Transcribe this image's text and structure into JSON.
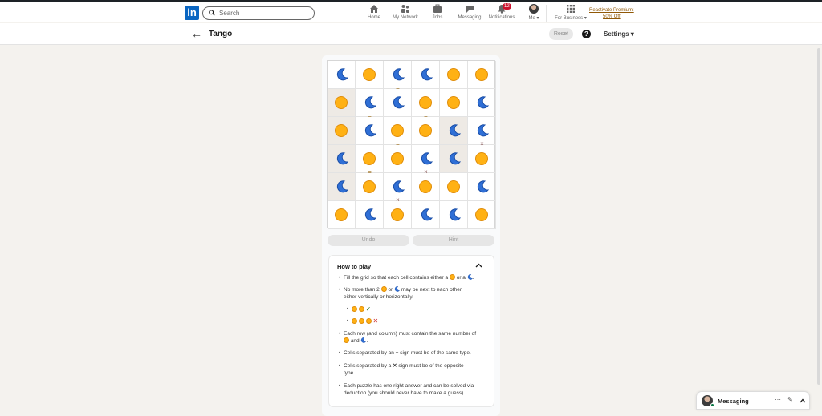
{
  "topbar": {
    "logo": "in",
    "search_placeholder": "Search",
    "nav": [
      {
        "label": "Home",
        "icon": "home-icon"
      },
      {
        "label": "My Network",
        "icon": "network-icon"
      },
      {
        "label": "Jobs",
        "icon": "jobs-icon"
      },
      {
        "label": "Messaging",
        "icon": "messaging-icon"
      },
      {
        "label": "Notifications",
        "icon": "bell-icon",
        "badge": "12"
      },
      {
        "label": "Me ▾",
        "icon": "avatar"
      },
      {
        "label": "For Business ▾",
        "icon": "grid-icon"
      }
    ],
    "premium_line1": "Reactivate Premium:",
    "premium_line2": "50% Off"
  },
  "subbar": {
    "back_glyph": "←",
    "title": "Tango",
    "reset": "Reset",
    "help_glyph": "?",
    "settings": "Settings ▾"
  },
  "game": {
    "grid": [
      [
        "M",
        "S",
        "M",
        "M",
        "S",
        "S"
      ],
      [
        "S",
        "M",
        "M",
        "S",
        "S",
        "M"
      ],
      [
        "S",
        "M",
        "S",
        "S",
        "M",
        "M"
      ],
      [
        "M",
        "S",
        "S",
        "M",
        "M",
        "S"
      ],
      [
        "M",
        "S",
        "M",
        "S",
        "S",
        "M"
      ],
      [
        "S",
        "M",
        "S",
        "M",
        "M",
        "S"
      ]
    ],
    "locked": [
      [
        1,
        0
      ],
      [
        2,
        0
      ],
      [
        2,
        4
      ],
      [
        3,
        0
      ],
      [
        3,
        4
      ],
      [
        4,
        0
      ]
    ],
    "signs": [
      {
        "between": [
          [
            0,
            2
          ],
          [
            1,
            2
          ]
        ],
        "type": "="
      },
      {
        "between": [
          [
            1,
            1
          ],
          [
            2,
            1
          ]
        ],
        "type": "="
      },
      {
        "between": [
          [
            1,
            3
          ],
          [
            2,
            3
          ]
        ],
        "type": "="
      },
      {
        "between": [
          [
            2,
            2
          ],
          [
            3,
            2
          ]
        ],
        "type": "="
      },
      {
        "between": [
          [
            2,
            5
          ],
          [
            3,
            5
          ]
        ],
        "type": "×"
      },
      {
        "between": [
          [
            3,
            1
          ],
          [
            4,
            1
          ]
        ],
        "type": "="
      },
      {
        "between": [
          [
            3,
            3
          ],
          [
            4,
            3
          ]
        ],
        "type": "×"
      },
      {
        "between": [
          [
            4,
            2
          ],
          [
            5,
            2
          ]
        ],
        "type": "×"
      }
    ],
    "colors": {
      "sun": "#ffb114",
      "moon": "#2f6fd6"
    },
    "undo": "Undo",
    "hint": "Hint"
  },
  "howto": {
    "title": "How to play",
    "caret": "^",
    "bullet": "•",
    "r1a": "Fill the grid so that each cell contains either a",
    "r1b": "or a",
    "r1c": ".",
    "r2a": "No more than 2",
    "r2b": "or",
    "r2c": "may be next to each other,",
    "r2d": "either vertically or horizontally.",
    "ok_mark": "✓",
    "bad_mark": "✕",
    "r3a": "Each row (and column) must contain the same number of",
    "r3b": "and",
    "r3c": ".",
    "r4": "Cells separated by an = sign must be of the same type.",
    "r5a": "Cells separated by a",
    "r5b": "✕",
    "r5c": "sign must be of the opposite",
    "r5d": "type.",
    "r6a": "Each puzzle has one right answer and can be solved via",
    "r6b": "deduction (you should never have to make a guess)."
  },
  "messaging": {
    "label": "Messaging",
    "more": "···",
    "compose": "✎",
    "collapse": "^"
  }
}
